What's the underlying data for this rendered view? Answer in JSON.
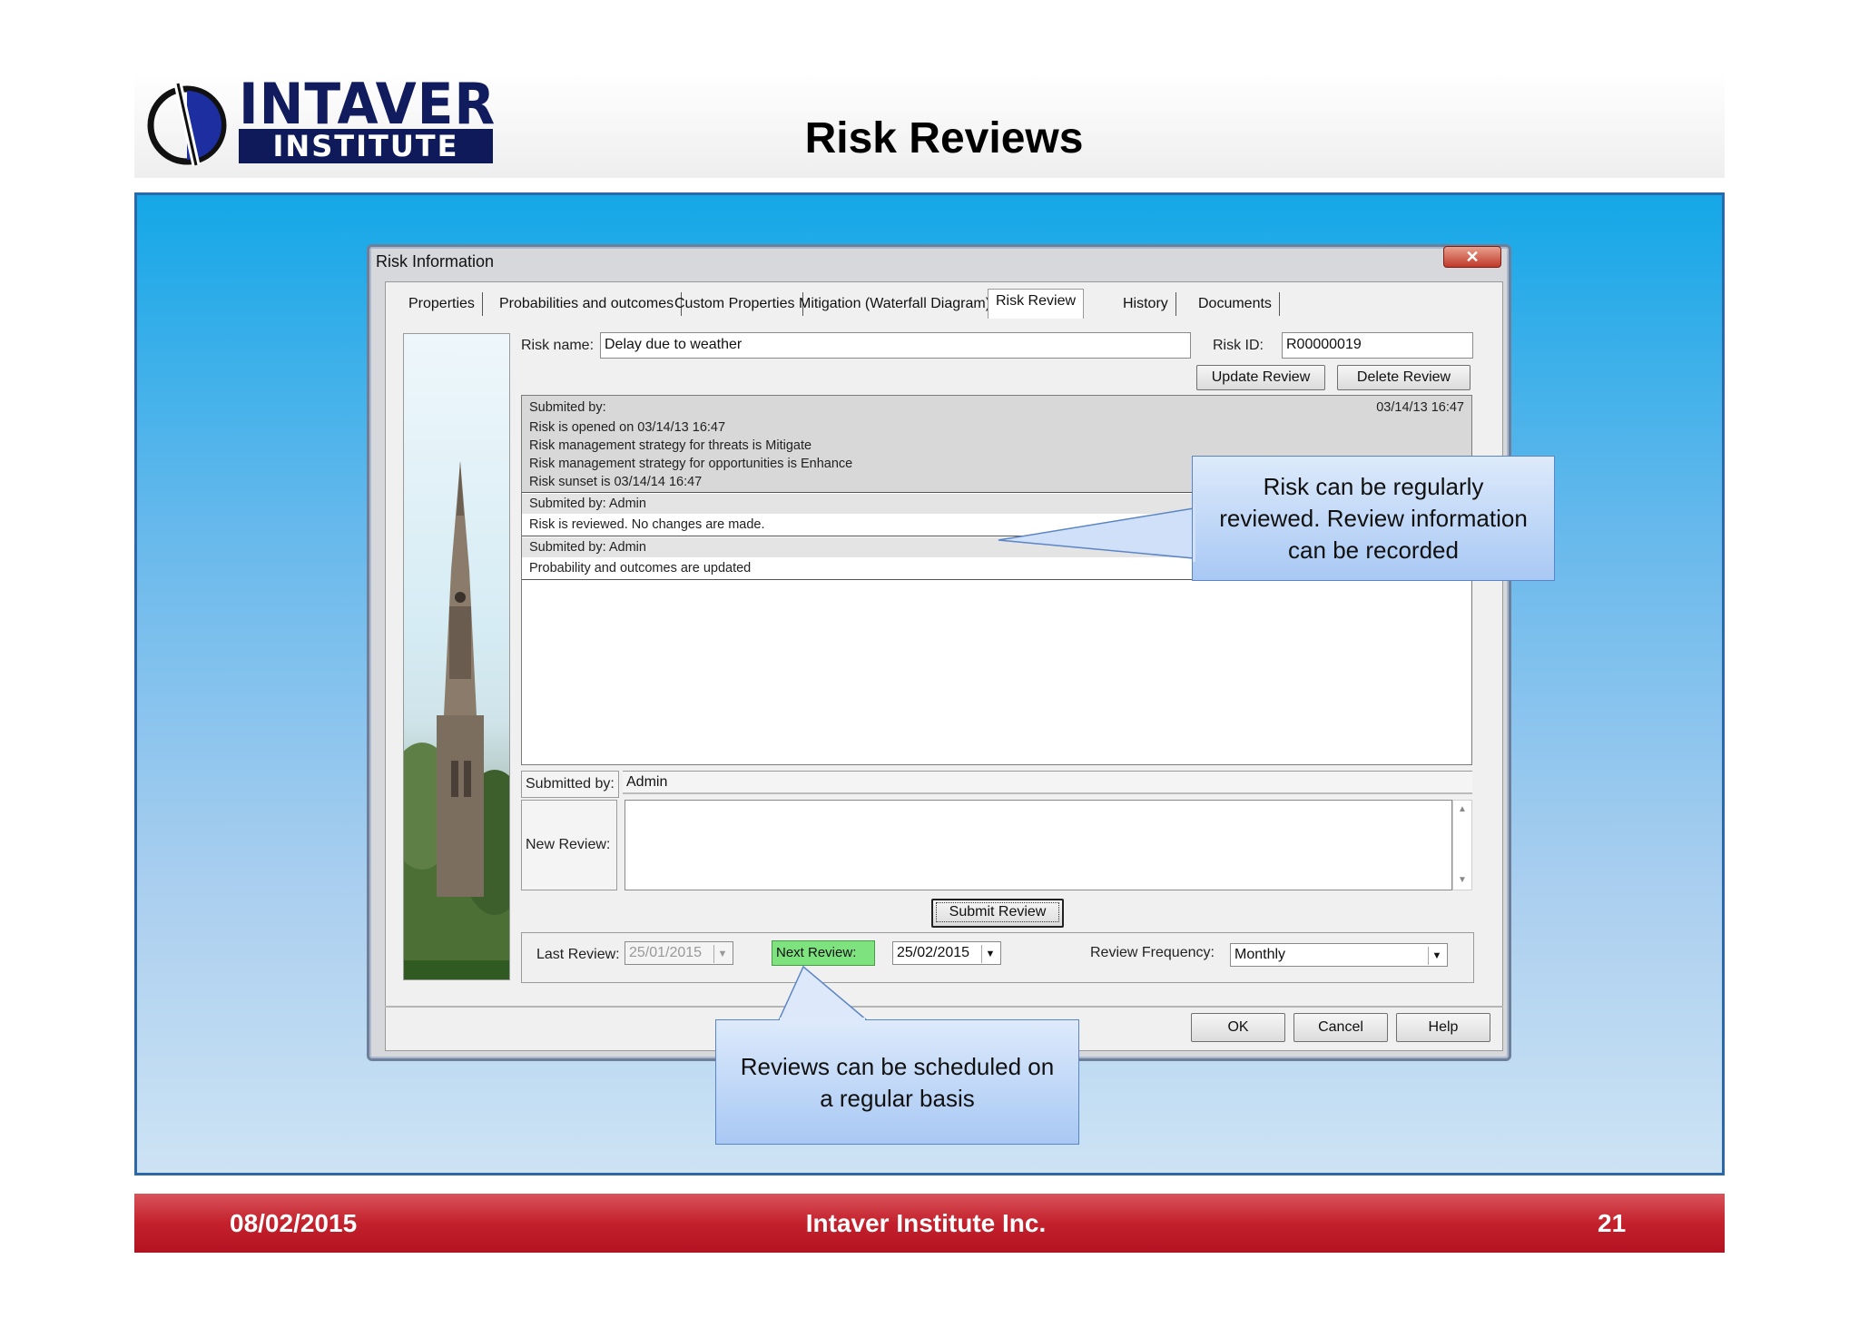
{
  "slide": {
    "logo": {
      "top": "INTAVER",
      "bottom": "INSTITUTE"
    },
    "title": "Risk Reviews",
    "footer": {
      "date": "08/02/2015",
      "company": "Intaver Institute Inc.",
      "page": "21"
    }
  },
  "dialog": {
    "title": "Risk Information",
    "close_symbol": "✕",
    "tabs": [
      "Properties",
      "Probabilities and outcomes",
      "Custom Properties",
      "Mitigation (Waterfall Diagram)",
      "Risk Review",
      "History",
      "Documents"
    ],
    "active_tab": "Risk Review",
    "risk_name_label": "Risk name:",
    "risk_name_value": "Delay due to weather",
    "risk_id_label": "Risk ID:",
    "risk_id_value": "R00000019",
    "update_review_label": "Update Review",
    "delete_review_label": "Delete Review",
    "reviews": [
      {
        "header": "Submited by:",
        "date": "03/14/13 16:47",
        "lines": [
          "Risk is opened on 03/14/13 16:47",
          "Risk management strategy for threats is Mitigate",
          "Risk management strategy for opportunities is Enhance",
          "Risk sunset is 03/14/14 16:47"
        ]
      },
      {
        "header": "Submited by: Admin",
        "date": "",
        "lines": [
          "Risk is reviewed. No changes are made."
        ]
      },
      {
        "header": "Submited by: Admin",
        "date": "",
        "lines": [
          "Probability and outcomes are updated"
        ]
      }
    ],
    "submitted_by_label": "Submitted by:",
    "submitted_by_value": "Admin",
    "new_review_label": "New Review:",
    "new_review_value": "",
    "submit_review_label": "Submit Review",
    "last_review_label": "Last Review:",
    "last_review_value": "25/01/2015",
    "next_review_label": "Next Review:",
    "next_review_value": "25/02/2015",
    "review_frequency_label": "Review Frequency:",
    "review_frequency_value": "Monthly",
    "ok_label": "OK",
    "cancel_label": "Cancel",
    "help_label": "Help"
  },
  "callouts": {
    "review_info": [
      "Risk can be regularly",
      "reviewed. Review information",
      "can be recorded"
    ],
    "schedule": [
      "Reviews can be scheduled on",
      "a regular basis"
    ]
  },
  "colors": {
    "header_navy": "#101c5e",
    "stage_blue": "#14a7e7",
    "footer_red": "#c3212c",
    "next_review_green": "#7ee37e",
    "callout_blue": "#a8c8f4"
  }
}
